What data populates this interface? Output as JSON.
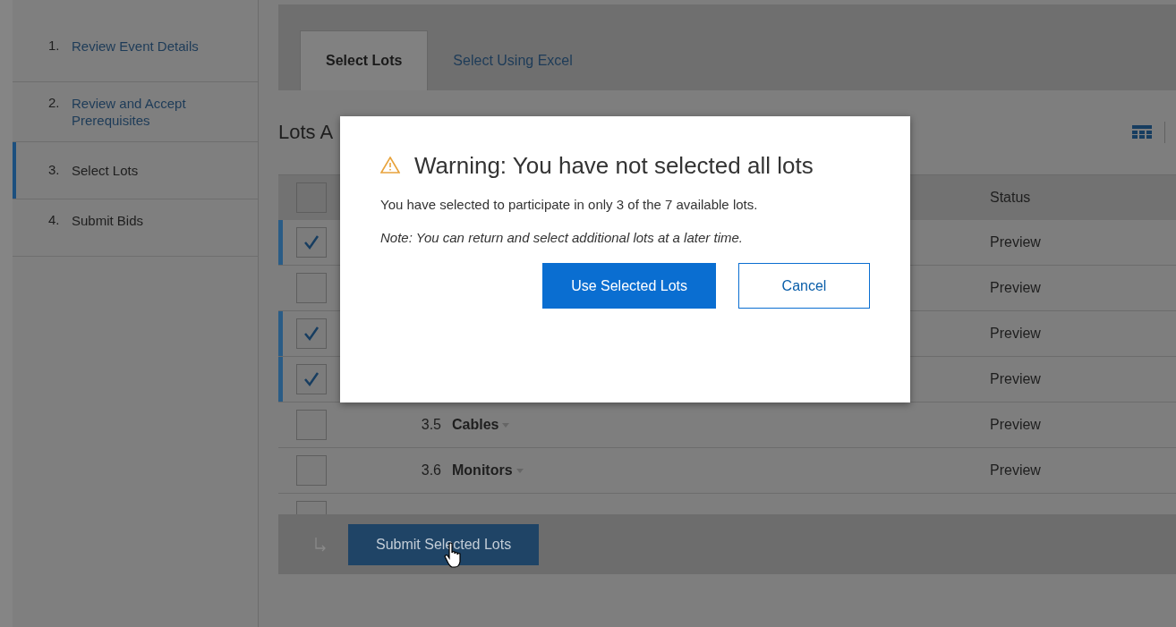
{
  "steps": [
    {
      "number": "1.",
      "label": "Review Event Details",
      "link": true,
      "selected": false
    },
    {
      "number": "2.",
      "label": "Review and Accept Prerequisites",
      "link": true,
      "selected": false
    },
    {
      "number": "3.",
      "label": "Select Lots",
      "link": false,
      "selected": true
    },
    {
      "number": "4.",
      "label": "Submit Bids",
      "link": false,
      "selected": false
    }
  ],
  "tabs": [
    {
      "label": "Select Lots",
      "selected": true
    },
    {
      "label": "Select Using Excel",
      "selected": false
    }
  ],
  "section_title": "Lots A",
  "table": {
    "select_all_checked": false,
    "columns": {
      "status": "Status"
    },
    "rows": [
      {
        "checked": true,
        "status": "Preview"
      },
      {
        "checked": false,
        "status": "Preview"
      },
      {
        "checked": true,
        "status": "Preview"
      },
      {
        "checked": true,
        "status": "Preview"
      },
      {
        "checked": false,
        "number": "3.5",
        "name": "Cables",
        "status": "Preview"
      },
      {
        "checked": false,
        "number": "3.6",
        "name": "Monitors",
        "status": "Preview"
      },
      {
        "checked": false
      }
    ]
  },
  "submit_button": "Submit Selected Lots",
  "dialog": {
    "title": "Warning: You have not selected all lots",
    "message": "You have selected to participate in only 3 of the 7 available lots.",
    "note": "Note: You can return and select additional lots at a later time.",
    "primary_button": "Use Selected Lots",
    "secondary_button": "Cancel"
  }
}
